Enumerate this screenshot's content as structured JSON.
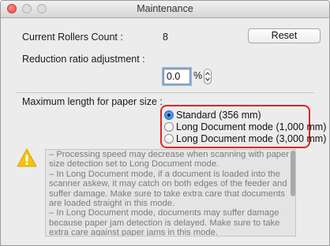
{
  "window": {
    "title": "Maintenance"
  },
  "rollers": {
    "label": "Current Rollers Count :",
    "value": "8",
    "reset_label": "Reset"
  },
  "reduction": {
    "label": "Reduction ratio adjustment :",
    "value": "0.0",
    "unit": "%"
  },
  "paper_size": {
    "label": "Maximum length for paper size :",
    "options": [
      {
        "label": "Standard (356 mm)",
        "selected": true
      },
      {
        "label": "Long Document mode (1,000 mm)",
        "selected": false
      },
      {
        "label": "Long Document mode (3,000 mm)",
        "selected": false
      }
    ]
  },
  "notes": {
    "icon": "warning-icon",
    "lines": [
      "– Processing speed may decrease when scanning with paper size detection set to Long Document mode.",
      "– In Long Document mode, if a document is loaded into the scanner askew, it may catch on both edges of the feeder and suffer damage. Make sure to take extra care that documents are loaded straight in this mode.",
      "– In Long Document mode, documents may suffer damage because paper jam detection is delayed. Make sure to take extra care against paper jams in this mode."
    ]
  },
  "colors": {
    "highlight": "#e2222b",
    "radio_selected": "#2b7ce8",
    "warning": "#f4c20d"
  }
}
